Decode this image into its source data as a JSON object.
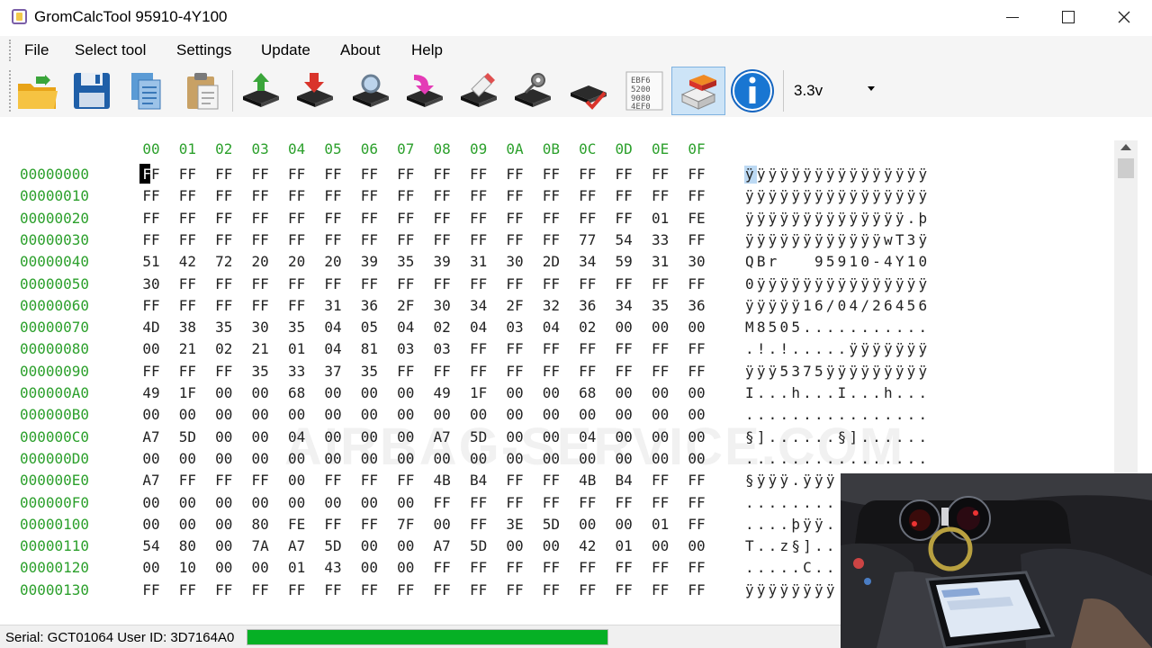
{
  "window": {
    "title": "GromCalcTool  95910-4Y100",
    "minimize_icon": "minimize-icon",
    "maximize_icon": "maximize-icon",
    "close_icon": "close-icon"
  },
  "menu": [
    "File",
    "Select tool",
    "Settings",
    "Update",
    "About",
    "Help"
  ],
  "toolbar": {
    "buttons": [
      "open-folder-icon",
      "save-disk-icon",
      "copy-pages-icon",
      "paste-clipboard-icon",
      "chip-read-up-icon",
      "chip-write-down-icon",
      "chip-search-icon",
      "chip-verify-pink-icon",
      "chip-erase-icon",
      "chip-settings-icon",
      "chip-check-icon",
      "hex-dump-icon",
      "airbag-module-icon",
      "info-icon"
    ],
    "active_index": 12,
    "voltage_value": "3.3v"
  },
  "hex": {
    "columns": [
      "00",
      "01",
      "02",
      "03",
      "04",
      "05",
      "06",
      "07",
      "08",
      "09",
      "0A",
      "0B",
      "0C",
      "0D",
      "0E",
      "0F"
    ],
    "rows": [
      {
        "addr": "00000000",
        "bytes": [
          "FF",
          "FF",
          "FF",
          "FF",
          "FF",
          "FF",
          "FF",
          "FF",
          "FF",
          "FF",
          "FF",
          "FF",
          "FF",
          "FF",
          "FF",
          "FF"
        ],
        "ascii": "ÿÿÿÿÿÿÿÿÿÿÿÿÿÿÿÿ"
      },
      {
        "addr": "00000010",
        "bytes": [
          "FF",
          "FF",
          "FF",
          "FF",
          "FF",
          "FF",
          "FF",
          "FF",
          "FF",
          "FF",
          "FF",
          "FF",
          "FF",
          "FF",
          "FF",
          "FF"
        ],
        "ascii": "ÿÿÿÿÿÿÿÿÿÿÿÿÿÿÿÿ"
      },
      {
        "addr": "00000020",
        "bytes": [
          "FF",
          "FF",
          "FF",
          "FF",
          "FF",
          "FF",
          "FF",
          "FF",
          "FF",
          "FF",
          "FF",
          "FF",
          "FF",
          "FF",
          "01",
          "FE"
        ],
        "ascii": "ÿÿÿÿÿÿÿÿÿÿÿÿÿÿ.þ"
      },
      {
        "addr": "00000030",
        "bytes": [
          "FF",
          "FF",
          "FF",
          "FF",
          "FF",
          "FF",
          "FF",
          "FF",
          "FF",
          "FF",
          "FF",
          "FF",
          "77",
          "54",
          "33",
          "FF"
        ],
        "ascii": "ÿÿÿÿÿÿÿÿÿÿÿÿwT3ÿ"
      },
      {
        "addr": "00000040",
        "bytes": [
          "51",
          "42",
          "72",
          "20",
          "20",
          "20",
          "39",
          "35",
          "39",
          "31",
          "30",
          "2D",
          "34",
          "59",
          "31",
          "30"
        ],
        "ascii": "QBr   95910-4Y10"
      },
      {
        "addr": "00000050",
        "bytes": [
          "30",
          "FF",
          "FF",
          "FF",
          "FF",
          "FF",
          "FF",
          "FF",
          "FF",
          "FF",
          "FF",
          "FF",
          "FF",
          "FF",
          "FF",
          "FF"
        ],
        "ascii": "0ÿÿÿÿÿÿÿÿÿÿÿÿÿÿÿ"
      },
      {
        "addr": "00000060",
        "bytes": [
          "FF",
          "FF",
          "FF",
          "FF",
          "FF",
          "31",
          "36",
          "2F",
          "30",
          "34",
          "2F",
          "32",
          "36",
          "34",
          "35",
          "36"
        ],
        "ascii": "ÿÿÿÿÿ16/04/26456"
      },
      {
        "addr": "00000070",
        "bytes": [
          "4D",
          "38",
          "35",
          "30",
          "35",
          "04",
          "05",
          "04",
          "02",
          "04",
          "03",
          "04",
          "02",
          "00",
          "00",
          "00"
        ],
        "ascii": "M8505..........."
      },
      {
        "addr": "00000080",
        "bytes": [
          "00",
          "21",
          "02",
          "21",
          "01",
          "04",
          "81",
          "03",
          "03",
          "FF",
          "FF",
          "FF",
          "FF",
          "FF",
          "FF",
          "FF"
        ],
        "ascii": ".!.!.....ÿÿÿÿÿÿÿ"
      },
      {
        "addr": "00000090",
        "bytes": [
          "FF",
          "FF",
          "FF",
          "35",
          "33",
          "37",
          "35",
          "FF",
          "FF",
          "FF",
          "FF",
          "FF",
          "FF",
          "FF",
          "FF",
          "FF"
        ],
        "ascii": "ÿÿÿ5375ÿÿÿÿÿÿÿÿÿ"
      },
      {
        "addr": "000000A0",
        "bytes": [
          "49",
          "1F",
          "00",
          "00",
          "68",
          "00",
          "00",
          "00",
          "49",
          "1F",
          "00",
          "00",
          "68",
          "00",
          "00",
          "00"
        ],
        "ascii": "I...h...I...h..."
      },
      {
        "addr": "000000B0",
        "bytes": [
          "00",
          "00",
          "00",
          "00",
          "00",
          "00",
          "00",
          "00",
          "00",
          "00",
          "00",
          "00",
          "00",
          "00",
          "00",
          "00"
        ],
        "ascii": "................"
      },
      {
        "addr": "000000C0",
        "bytes": [
          "A7",
          "5D",
          "00",
          "00",
          "04",
          "00",
          "00",
          "00",
          "A7",
          "5D",
          "00",
          "00",
          "04",
          "00",
          "00",
          "00"
        ],
        "ascii": "§]......§]......"
      },
      {
        "addr": "000000D0",
        "bytes": [
          "00",
          "00",
          "00",
          "00",
          "00",
          "00",
          "00",
          "00",
          "00",
          "00",
          "00",
          "00",
          "00",
          "00",
          "00",
          "00"
        ],
        "ascii": "................"
      },
      {
        "addr": "000000E0",
        "bytes": [
          "A7",
          "FF",
          "FF",
          "FF",
          "00",
          "FF",
          "FF",
          "FF",
          "4B",
          "B4",
          "FF",
          "FF",
          "4B",
          "B4",
          "FF",
          "FF"
        ],
        "ascii": "§ÿÿÿ.ÿÿÿ"
      },
      {
        "addr": "000000F0",
        "bytes": [
          "00",
          "00",
          "00",
          "00",
          "00",
          "00",
          "00",
          "00",
          "FF",
          "FF",
          "FF",
          "FF",
          "FF",
          "FF",
          "FF",
          "FF"
        ],
        "ascii": "........"
      },
      {
        "addr": "00000100",
        "bytes": [
          "00",
          "00",
          "00",
          "80",
          "FE",
          "FF",
          "FF",
          "7F",
          "00",
          "FF",
          "3E",
          "5D",
          "00",
          "00",
          "01",
          "FF"
        ],
        "ascii": "....þÿÿ."
      },
      {
        "addr": "00000110",
        "bytes": [
          "54",
          "80",
          "00",
          "7A",
          "A7",
          "5D",
          "00",
          "00",
          "A7",
          "5D",
          "00",
          "00",
          "42",
          "01",
          "00",
          "00"
        ],
        "ascii": "T..z§]..."
      },
      {
        "addr": "00000120",
        "bytes": [
          "00",
          "10",
          "00",
          "00",
          "01",
          "43",
          "00",
          "00",
          "FF",
          "FF",
          "FF",
          "FF",
          "FF",
          "FF",
          "FF",
          "FF"
        ],
        "ascii": ".....C.."
      },
      {
        "addr": "00000130",
        "bytes": [
          "FF",
          "FF",
          "FF",
          "FF",
          "FF",
          "FF",
          "FF",
          "FF",
          "FF",
          "FF",
          "FF",
          "FF",
          "FF",
          "FF",
          "FF",
          "FF"
        ],
        "ascii": "ÿÿÿÿÿÿÿÿ"
      }
    ]
  },
  "watermark": "AIRBAG-SERVICE.COM",
  "status": {
    "text": "Serial: GCT01064 User ID: 3D7164A0",
    "progress_fraction": 1.0,
    "progress_color": "#06b025"
  },
  "colors": {
    "address": "#2ca02c",
    "header": "#2ca02c",
    "selection": "#bcd9f3"
  }
}
